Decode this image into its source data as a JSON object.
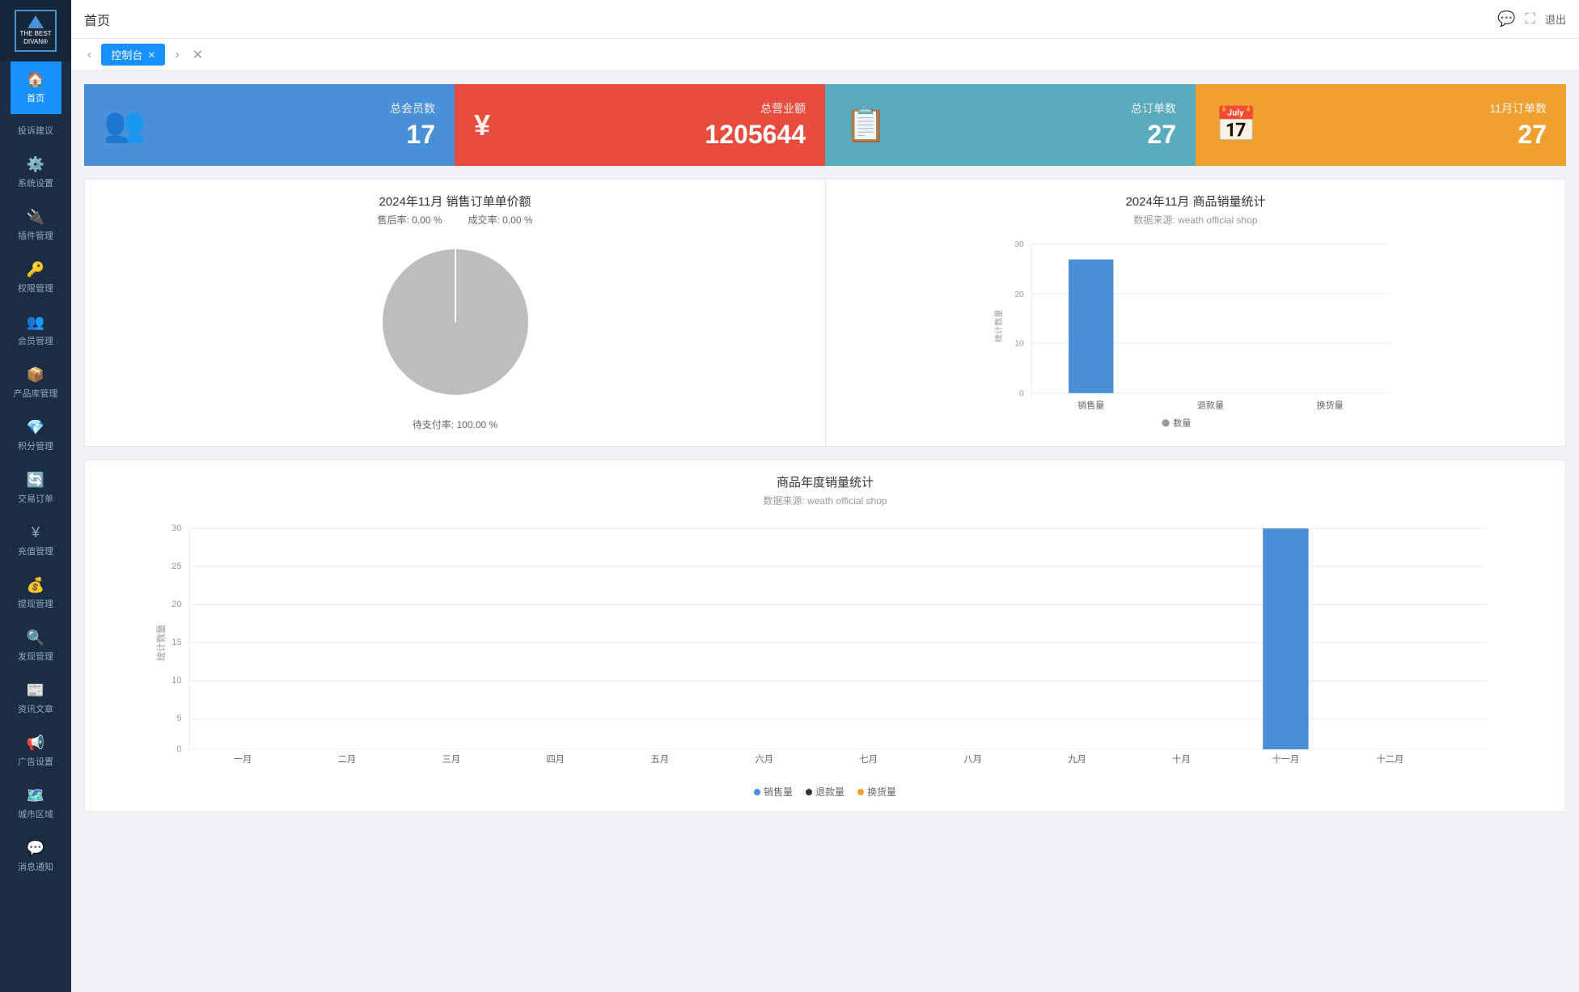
{
  "sidebar": {
    "logo": {
      "line1": "THE BEST",
      "line2": "DIVAN®"
    },
    "items": [
      {
        "id": "home",
        "label": "首页",
        "icon": "🏠",
        "active": true
      },
      {
        "id": "settings",
        "label": "系统设置",
        "icon": "⚙️",
        "active": false
      },
      {
        "id": "plugins",
        "label": "插件管理",
        "icon": "🔌",
        "active": false
      },
      {
        "id": "permissions",
        "label": "权限管理",
        "icon": "🔑",
        "active": false
      },
      {
        "id": "members",
        "label": "会员管理",
        "icon": "👥",
        "active": false
      },
      {
        "id": "products",
        "label": "产品库管理",
        "icon": "📦",
        "active": false
      },
      {
        "id": "points",
        "label": "积分管理",
        "icon": "💎",
        "active": false
      },
      {
        "id": "orders",
        "label": "交易订单",
        "icon": "🔄",
        "active": false
      },
      {
        "id": "recharge",
        "label": "充值管理",
        "icon": "¥",
        "active": false
      },
      {
        "id": "withdraw",
        "label": "提现管理",
        "icon": "💰",
        "active": false
      },
      {
        "id": "discover",
        "label": "发现管理",
        "icon": "🔍",
        "active": false
      },
      {
        "id": "news",
        "label": "资讯文章",
        "icon": "📰",
        "active": false
      },
      {
        "id": "ads",
        "label": "广告设置",
        "icon": "📢",
        "active": false
      },
      {
        "id": "region",
        "label": "城市区域",
        "icon": "🗺️",
        "active": false
      },
      {
        "id": "notify",
        "label": "消息通知",
        "icon": "💬",
        "active": false
      }
    ]
  },
  "topbar": {
    "title": "首页",
    "message_icon": "💬",
    "screen_icon": "⛶",
    "logout_label": "退出"
  },
  "tabs": [
    {
      "label": "控制台",
      "active": true,
      "closable": true
    }
  ],
  "stat_cards": [
    {
      "id": "total-members",
      "label": "总会员数",
      "value": "17",
      "color": "blue"
    },
    {
      "id": "total-revenue",
      "label": "总营业额",
      "value": "1205644",
      "color": "red",
      "prefix": "¥"
    },
    {
      "id": "total-orders",
      "label": "总订单数",
      "value": "27",
      "color": "teal"
    },
    {
      "id": "monthly-orders",
      "label": "11月订单数",
      "value": "27",
      "color": "orange"
    }
  ],
  "pie_chart": {
    "title": "2024年11月 销售订单单价额",
    "labels": {
      "top_left": "售后率: 0.00 %",
      "top_right": "成交率: 0.00 %",
      "bottom": "待支付率: 100.00 %"
    },
    "segments": [
      {
        "label": "待支付",
        "value": 100,
        "color": "#bdbdbd"
      }
    ]
  },
  "bar_chart": {
    "title": "2024年11月 商品销量统计",
    "subtitle": "数据来源: weath official shop",
    "y_labels": [
      0,
      10,
      20,
      30
    ],
    "x_labels": [
      "销售量",
      "退款量",
      "换货量"
    ],
    "legend_label": "数量",
    "bars": [
      {
        "label": "销售量",
        "value": 27,
        "max": 30,
        "color": "#4a90d9"
      },
      {
        "label": "退款量",
        "value": 0,
        "max": 30,
        "color": "#4a90d9"
      },
      {
        "label": "换货量",
        "value": 0,
        "max": 30,
        "color": "#4a90d9"
      }
    ]
  },
  "annual_chart": {
    "title": "商品年度销量统计",
    "subtitle": "数据来源: weath official shop",
    "y_labels": [
      0,
      5,
      10,
      15,
      20,
      25,
      30
    ],
    "x_labels": [
      "一月",
      "二月",
      "三月",
      "四月",
      "五月",
      "六月",
      "七月",
      "八月",
      "九月",
      "十月",
      "十一月",
      "十二月"
    ],
    "legend": [
      {
        "label": "销售量",
        "color": "#4a90d9"
      },
      {
        "label": "退款量",
        "color": "#333"
      },
      {
        "label": "换货量",
        "color": "#f0a030"
      }
    ],
    "bars": [
      {
        "month": "一月",
        "sales": 0,
        "returns": 0,
        "exchanges": 0
      },
      {
        "month": "二月",
        "sales": 0,
        "returns": 0,
        "exchanges": 0
      },
      {
        "month": "三月",
        "sales": 0,
        "returns": 0,
        "exchanges": 0
      },
      {
        "month": "四月",
        "sales": 0,
        "returns": 0,
        "exchanges": 0
      },
      {
        "month": "五月",
        "sales": 0,
        "returns": 0,
        "exchanges": 0
      },
      {
        "month": "六月",
        "sales": 0,
        "returns": 0,
        "exchanges": 0
      },
      {
        "month": "七月",
        "sales": 0,
        "returns": 0,
        "exchanges": 0
      },
      {
        "month": "八月",
        "sales": 0,
        "returns": 0,
        "exchanges": 0
      },
      {
        "month": "九月",
        "sales": 0,
        "returns": 0,
        "exchanges": 0
      },
      {
        "month": "十月",
        "sales": 0,
        "returns": 0,
        "exchanges": 0
      },
      {
        "month": "十一月",
        "sales": 27,
        "returns": 0,
        "exchanges": 0
      },
      {
        "month": "十二月",
        "sales": 0,
        "returns": 0,
        "exchanges": 0
      }
    ]
  },
  "complaint": {
    "label": "投诉建议"
  }
}
